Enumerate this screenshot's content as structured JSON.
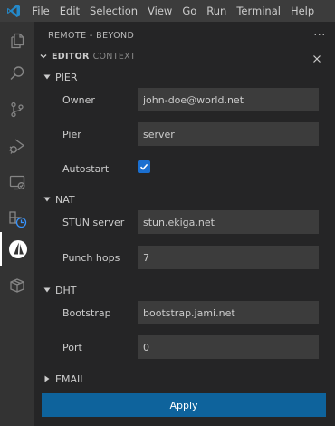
{
  "menu": {
    "items": [
      "File",
      "Edit",
      "Selection",
      "View",
      "Go",
      "Run",
      "Terminal",
      "Help"
    ]
  },
  "activity_bar": {
    "icons": [
      "explorer-icon",
      "search-icon",
      "source-control-icon",
      "run-debug-icon",
      "remote-explorer-icon",
      "extensions-icon",
      "beyond-icon",
      "package-icon"
    ],
    "active": "beyond-icon"
  },
  "sidebar": {
    "title": "REMOTE - BEYOND",
    "more": "···",
    "tabs": [
      {
        "label": "EDITOR",
        "active": true
      },
      {
        "label": "CONTEXT",
        "active": false
      }
    ]
  },
  "sections": {
    "pier": {
      "label": "PIER",
      "owner_label": "Owner",
      "owner_value": "john-doe@world.net",
      "pier_label": "Pier",
      "pier_value": "server",
      "autostart_label": "Autostart",
      "autostart_checked": true
    },
    "nat": {
      "label": "NAT",
      "stun_label": "STUN server",
      "stun_value": "stun.ekiga.net",
      "hops_label": "Punch hops",
      "hops_value": "7"
    },
    "dht": {
      "label": "DHT",
      "bootstrap_label": "Bootstrap",
      "bootstrap_value": "bootstrap.jami.net",
      "port_label": "Port",
      "port_value": "0"
    },
    "email": {
      "label": "EMAIL",
      "collapsed": true
    }
  },
  "apply_label": "Apply",
  "colors": {
    "accent": "#0e639c",
    "checkbox": "#1a6fd0",
    "activity_bar": "#333333",
    "sidebar": "#252526",
    "input": "#3c3c3c"
  }
}
